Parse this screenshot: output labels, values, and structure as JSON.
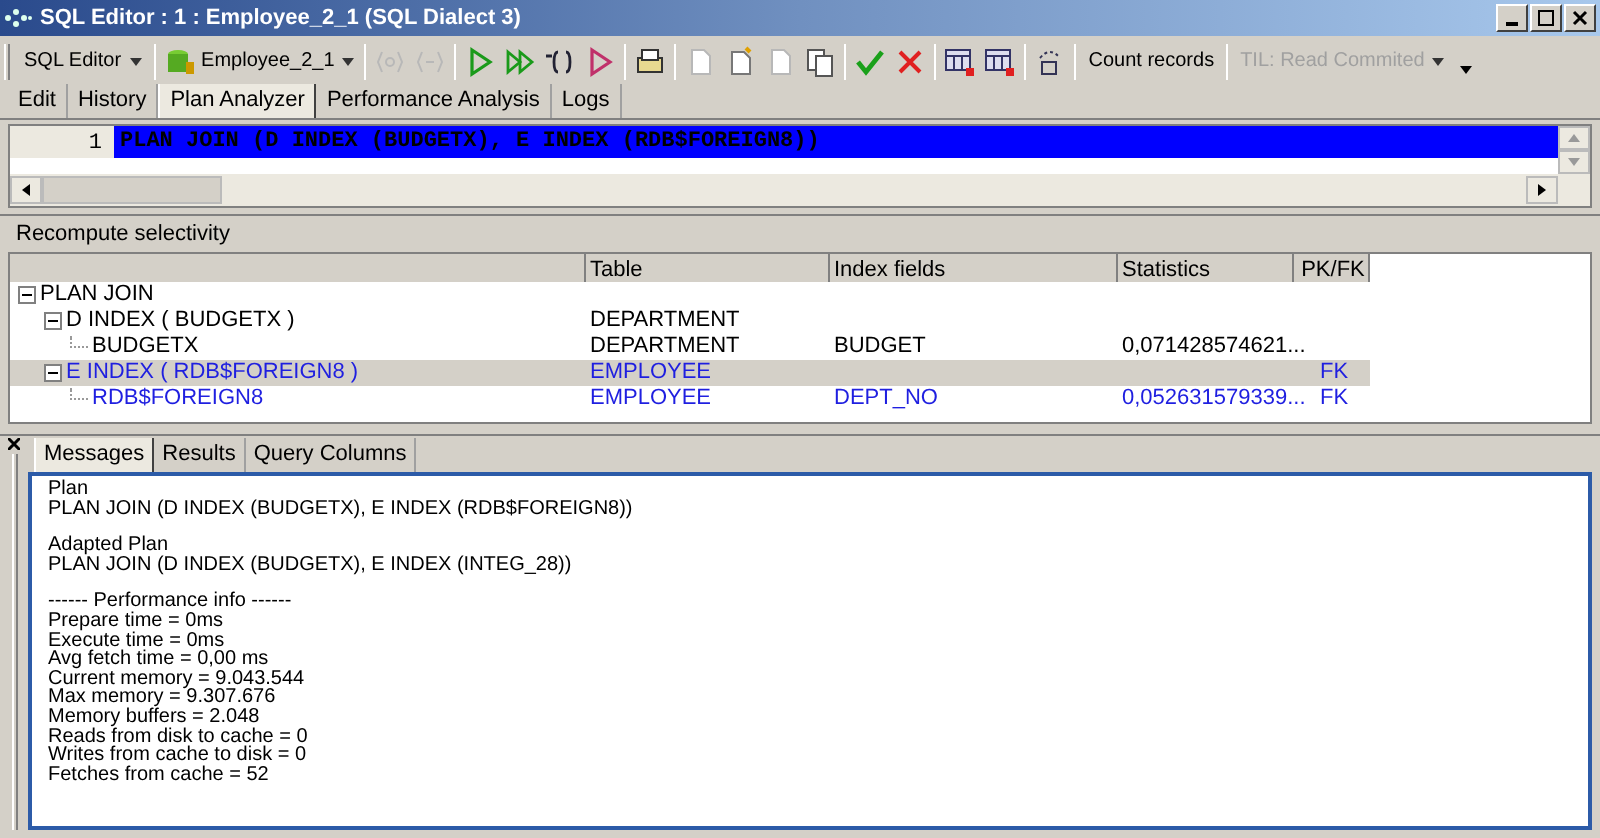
{
  "window": {
    "title": "SQL Editor : 1 : Employee_2_1 (SQL Dialect 3)"
  },
  "toolbar": {
    "mode_button": "SQL Editor",
    "connection_button": "Employee_2_1",
    "icons": [
      {
        "kind": "braces-query",
        "disabled": true
      },
      {
        "kind": "braces-next",
        "disabled": true
      },
      {
        "kind": "run",
        "disabled": false
      },
      {
        "kind": "run-all",
        "disabled": false
      },
      {
        "kind": "run-block",
        "disabled": false
      },
      {
        "kind": "debug",
        "disabled": false
      },
      {
        "kind": "print",
        "disabled": false
      },
      {
        "kind": "doc",
        "disabled": true
      },
      {
        "kind": "doc-new",
        "disabled": false
      },
      {
        "kind": "doc",
        "disabled": true
      },
      {
        "kind": "copy",
        "disabled": false
      },
      {
        "kind": "commit",
        "disabled": false
      },
      {
        "kind": "rollback",
        "disabled": false
      },
      {
        "kind": "grid",
        "disabled": false
      },
      {
        "kind": "grid",
        "disabled": false
      },
      {
        "kind": "refresh",
        "disabled": false
      }
    ],
    "count_button": "Count records",
    "til_dropdown": {
      "label": "TIL: Read Commited",
      "disabled": true
    }
  },
  "tabs": [
    {
      "label": "Edit",
      "selected": false
    },
    {
      "label": "History",
      "selected": false
    },
    {
      "label": "Plan Analyzer",
      "selected": true
    },
    {
      "label": "Performance Analysis",
      "selected": false
    },
    {
      "label": "Logs",
      "selected": false
    }
  ],
  "editor": {
    "lines": [
      {
        "number": "1",
        "text": "PLAN JOIN (D INDEX (BUDGETX), E INDEX (RDB$FOREIGN8))",
        "selected": true
      }
    ]
  },
  "recompute_button": "Recompute selectivity",
  "plan_tree": {
    "columns": [
      "Table",
      "Index fields",
      "Statistics",
      "PK/FK"
    ],
    "rows": [
      {
        "name": "PLAN JOIN",
        "cells": [],
        "expanded": true,
        "selected": false,
        "color": "#000000",
        "children": [
          {
            "name": "D INDEX ( BUDGETX )",
            "cells": [
              "DEPARTMENT"
            ],
            "expanded": true,
            "selected": false,
            "color": "#000000",
            "children": [
              {
                "name": "BUDGETX",
                "cells": [
                  "DEPARTMENT",
                  "BUDGET",
                  "0,071428574621..."
                ],
                "selected": false,
                "color": "#000000"
              }
            ]
          },
          {
            "name": "E INDEX ( RDB$FOREIGN8 )",
            "cells": [
              "EMPLOYEE",
              "",
              "",
              "FK"
            ],
            "expanded": true,
            "selected": true,
            "color": "#1f1fe0",
            "children": [
              {
                "name": "RDB$FOREIGN8",
                "cells": [
                  "EMPLOYEE",
                  "DEPT_NO",
                  "0,052631579339...",
                  "FK"
                ],
                "selected": false,
                "color": "#1f1fe0"
              }
            ]
          }
        ]
      }
    ]
  },
  "bottom_tabs": [
    {
      "label": "Messages",
      "selected": true
    },
    {
      "label": "Results",
      "selected": false
    },
    {
      "label": "Query Columns",
      "selected": false
    }
  ],
  "messages": [
    [
      "Plan",
      "PLAN JOIN (D INDEX (BUDGETX), E INDEX (RDB$FOREIGN8))"
    ],
    [
      "Adapted Plan",
      "PLAN JOIN (D INDEX (BUDGETX), E INDEX (INTEG_28))"
    ],
    [
      "------ Performance info ------",
      "Prepare time = 0ms",
      "Execute time = 0ms",
      "Avg fetch time = 0,00 ms",
      "Current memory = 9.043.544",
      "Max memory = 9.307.676",
      "Memory buffers = 2.048",
      "Reads from disk to cache = 0",
      "Writes from cache to disk = 0",
      "Fetches from cache = 52"
    ]
  ]
}
